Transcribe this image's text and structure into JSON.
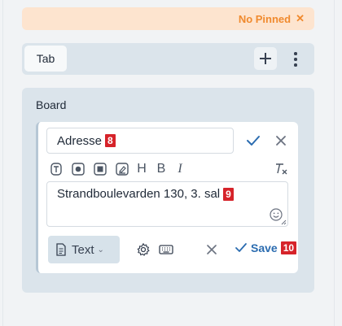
{
  "pinned_bar": {
    "label": "No Pinned",
    "close_symbol": "✕"
  },
  "tabs": [
    {
      "label": "Tab"
    }
  ],
  "board": {
    "title": "Board",
    "editor": {
      "title_value": "Adresse",
      "title_marker": "8",
      "formatting_toolbar": [
        "text-style-icon",
        "radio-icon",
        "checkbox-icon",
        "signature-icon",
        "H",
        "B",
        "I",
        "clear-format-icon"
      ],
      "body_value": "Strandboulevarden 130, 3. sal",
      "body_marker": "9",
      "type_select": "Text",
      "save_label": "Save",
      "save_marker": "10"
    }
  },
  "colors": {
    "accent": "#2b6cb0",
    "pinned_text": "#f08a2e",
    "pinned_bg": "#fde4cf",
    "marker": "#d6232a"
  }
}
